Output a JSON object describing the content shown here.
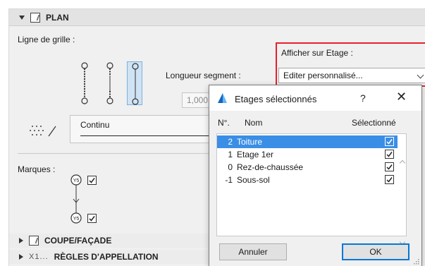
{
  "section_plan": {
    "title": "PLAN"
  },
  "grid_line": {
    "label": "Ligne de grille :"
  },
  "segment": {
    "label": "Longueur segment :",
    "value": "1,000"
  },
  "line_type": {
    "value": "Continu"
  },
  "markers": {
    "label": "Marques :",
    "marker_text": "Y5"
  },
  "floor_display": {
    "label": "Afficher sur Etage :",
    "selected": "Editer personnalisé..."
  },
  "section_coupe": {
    "title": "COUPE/FAÇADE"
  },
  "section_naming": {
    "prefix": "X1...",
    "title": "RÈGLES D'APPELLATION"
  },
  "dialog": {
    "title": "Etages sélectionnés",
    "help": "?",
    "close": "✕",
    "columns": {
      "num": "N°.",
      "name": "Nom",
      "selected": "Sélectionné"
    },
    "rows": [
      {
        "num": "2",
        "name": "Toiture",
        "checked": true,
        "selected": true
      },
      {
        "num": "1",
        "name": "Etage 1er",
        "checked": true,
        "selected": false
      },
      {
        "num": "0",
        "name": "Rez-de-chaussée",
        "checked": true,
        "selected": false
      },
      {
        "num": "-1",
        "name": "Sous-sol",
        "checked": true,
        "selected": false
      }
    ],
    "cancel_label": "Annuler",
    "ok_label": "OK"
  },
  "colors": {
    "highlight": "#e8202a",
    "selection": "#3a8ee6",
    "ok_border": "#0078d7"
  }
}
